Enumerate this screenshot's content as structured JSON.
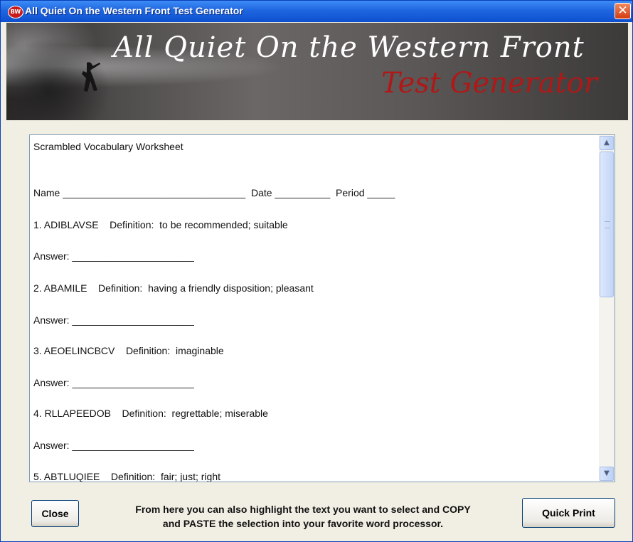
{
  "window": {
    "title": "All Quiet On the Western Front Test Generator",
    "app_icon_text": "BW",
    "close_glyph": "✕"
  },
  "banner": {
    "line1": "All Quiet On the Western Front",
    "line2": "Test Generator"
  },
  "worksheet": {
    "title": "Scrambled Vocabulary Worksheet",
    "name_line": "Name _________________________________  Date __________  Period _____",
    "items": [
      {
        "question": "1. ADIBLAVSE    Definition:  to be recommended; suitable",
        "answer": "Answer: ______________________"
      },
      {
        "question": "2. ABAMILE    Definition:  having a friendly disposition; pleasant",
        "answer": "Answer: ______________________"
      },
      {
        "question": "3. AEOELINCBCV    Definition:  imaginable",
        "answer": "Answer: ______________________"
      },
      {
        "question": "4. RLLAPEEDOB    Definition:  regrettable; miserable",
        "answer": "Answer: ______________________"
      },
      {
        "question": "5. ABTLUQIEE    Definition:  fair; just; right"
      }
    ]
  },
  "scrollbar": {
    "up_glyph": "▲",
    "down_glyph": "▼"
  },
  "footer": {
    "close_label": "Close",
    "hint_line1": "From here you can also highlight the text you want to select and COPY",
    "hint_line2": "and PASTE the selection into your favorite word processor.",
    "print_label": "Quick Print"
  },
  "colors": {
    "titlebar": "#1f66e0",
    "banner_title": "#ffffff",
    "banner_subtitle": "#b01818",
    "window_bg": "#f1efe4"
  }
}
